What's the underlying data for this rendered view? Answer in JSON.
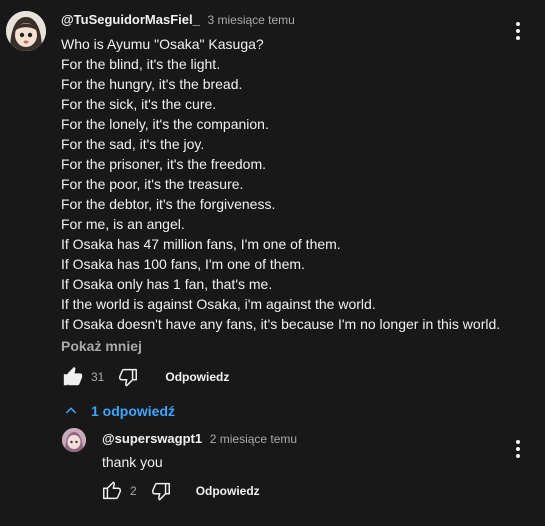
{
  "comment": {
    "author": "@TuSeguidorMasFiel_",
    "time": "3 miesiące temu",
    "lines": [
      "Who is Ayumu \"Osaka\" Kasuga?",
      "For the blind, it's the light.",
      "For the hungry, it's the bread.",
      "For the sick, it's the cure.",
      "For the lonely, it's the companion.",
      "For the sad, it's the joy.",
      "For the prisoner, it's the freedom.",
      "For the poor, it's the treasure.",
      "For the debtor, it's the forgiveness.",
      "For me, is an angel.",
      "If Osaka has 47 million fans, I'm one of them.",
      "If Osaka has 100 fans, I'm one of them.",
      "If Osaka only has 1 fan, that's me.",
      "If the world is against Osaka, i'm against the world.",
      "If Osaka doesn't have any fans, it's because I'm no longer in this world."
    ],
    "show_less": "Pokaż mniej",
    "likes": "31",
    "reply_label": "Odpowiedz"
  },
  "replies_toggle": {
    "label": "1 odpowiedź"
  },
  "reply": {
    "author": "@superswagpt1",
    "time": "2 miesiące temu",
    "text": "thank you",
    "likes": "2",
    "reply_label": "Odpowiedz"
  },
  "colors": {
    "background": "#181818",
    "text": "#f1f1f1",
    "secondary": "#aaaaaa",
    "link": "#3ea6ff"
  },
  "icons": [
    "more-vert-icon",
    "thumb-up-icon",
    "thumb-down-icon",
    "chevron-up-icon"
  ]
}
